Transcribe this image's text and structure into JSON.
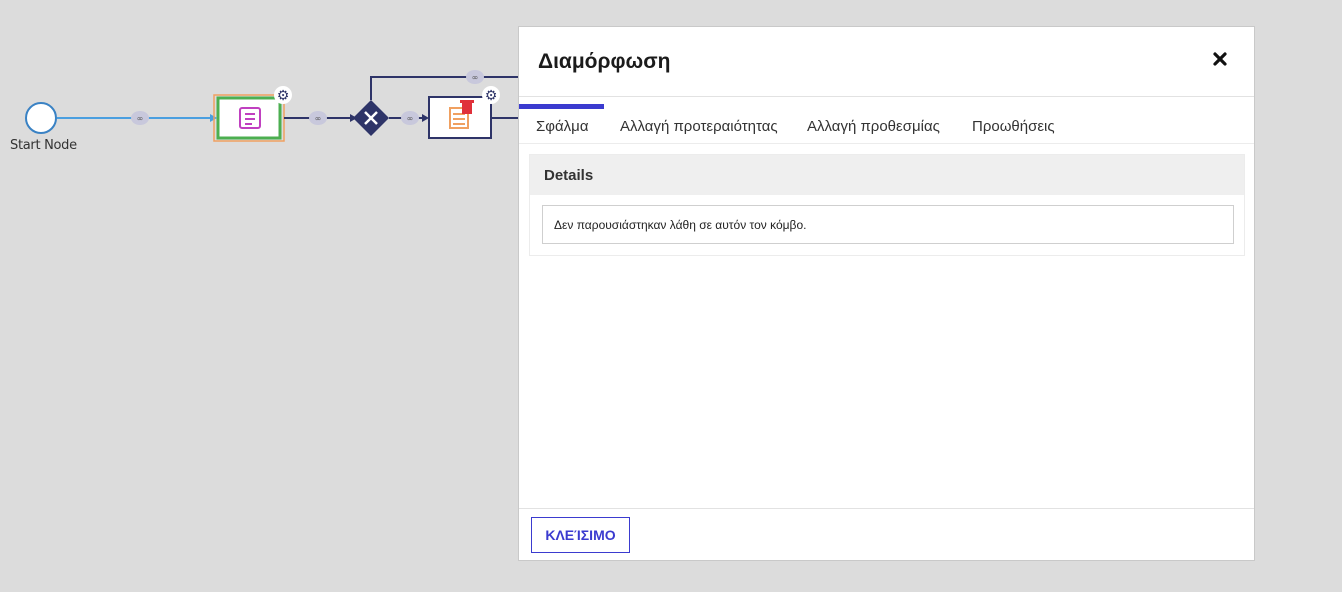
{
  "workflow": {
    "start_node_label": "Start Node"
  },
  "modal": {
    "title": "Διαμόρφωση",
    "tabs": [
      {
        "label": "Σφάλμα",
        "active": true
      },
      {
        "label": "Αλλαγή προτεραιότητας",
        "active": false
      },
      {
        "label": "Αλλαγή προθεσμίας",
        "active": false
      },
      {
        "label": "Προωθήσεις",
        "active": false
      }
    ],
    "details": {
      "title": "Details",
      "message": "Δεν παρουσιάστηκαν λάθη σε αυτόν τον κόμβο."
    },
    "close_label": "ΚΛΕΊΣΙΜΟ"
  },
  "colors": {
    "accent": "#3b3bcf",
    "gateway": "#2e3468",
    "edge_blue": "#4a9fe0",
    "task_highlight": "#4caf50",
    "task_icon": "#c040c0",
    "delete_icon": "#e0303a"
  }
}
